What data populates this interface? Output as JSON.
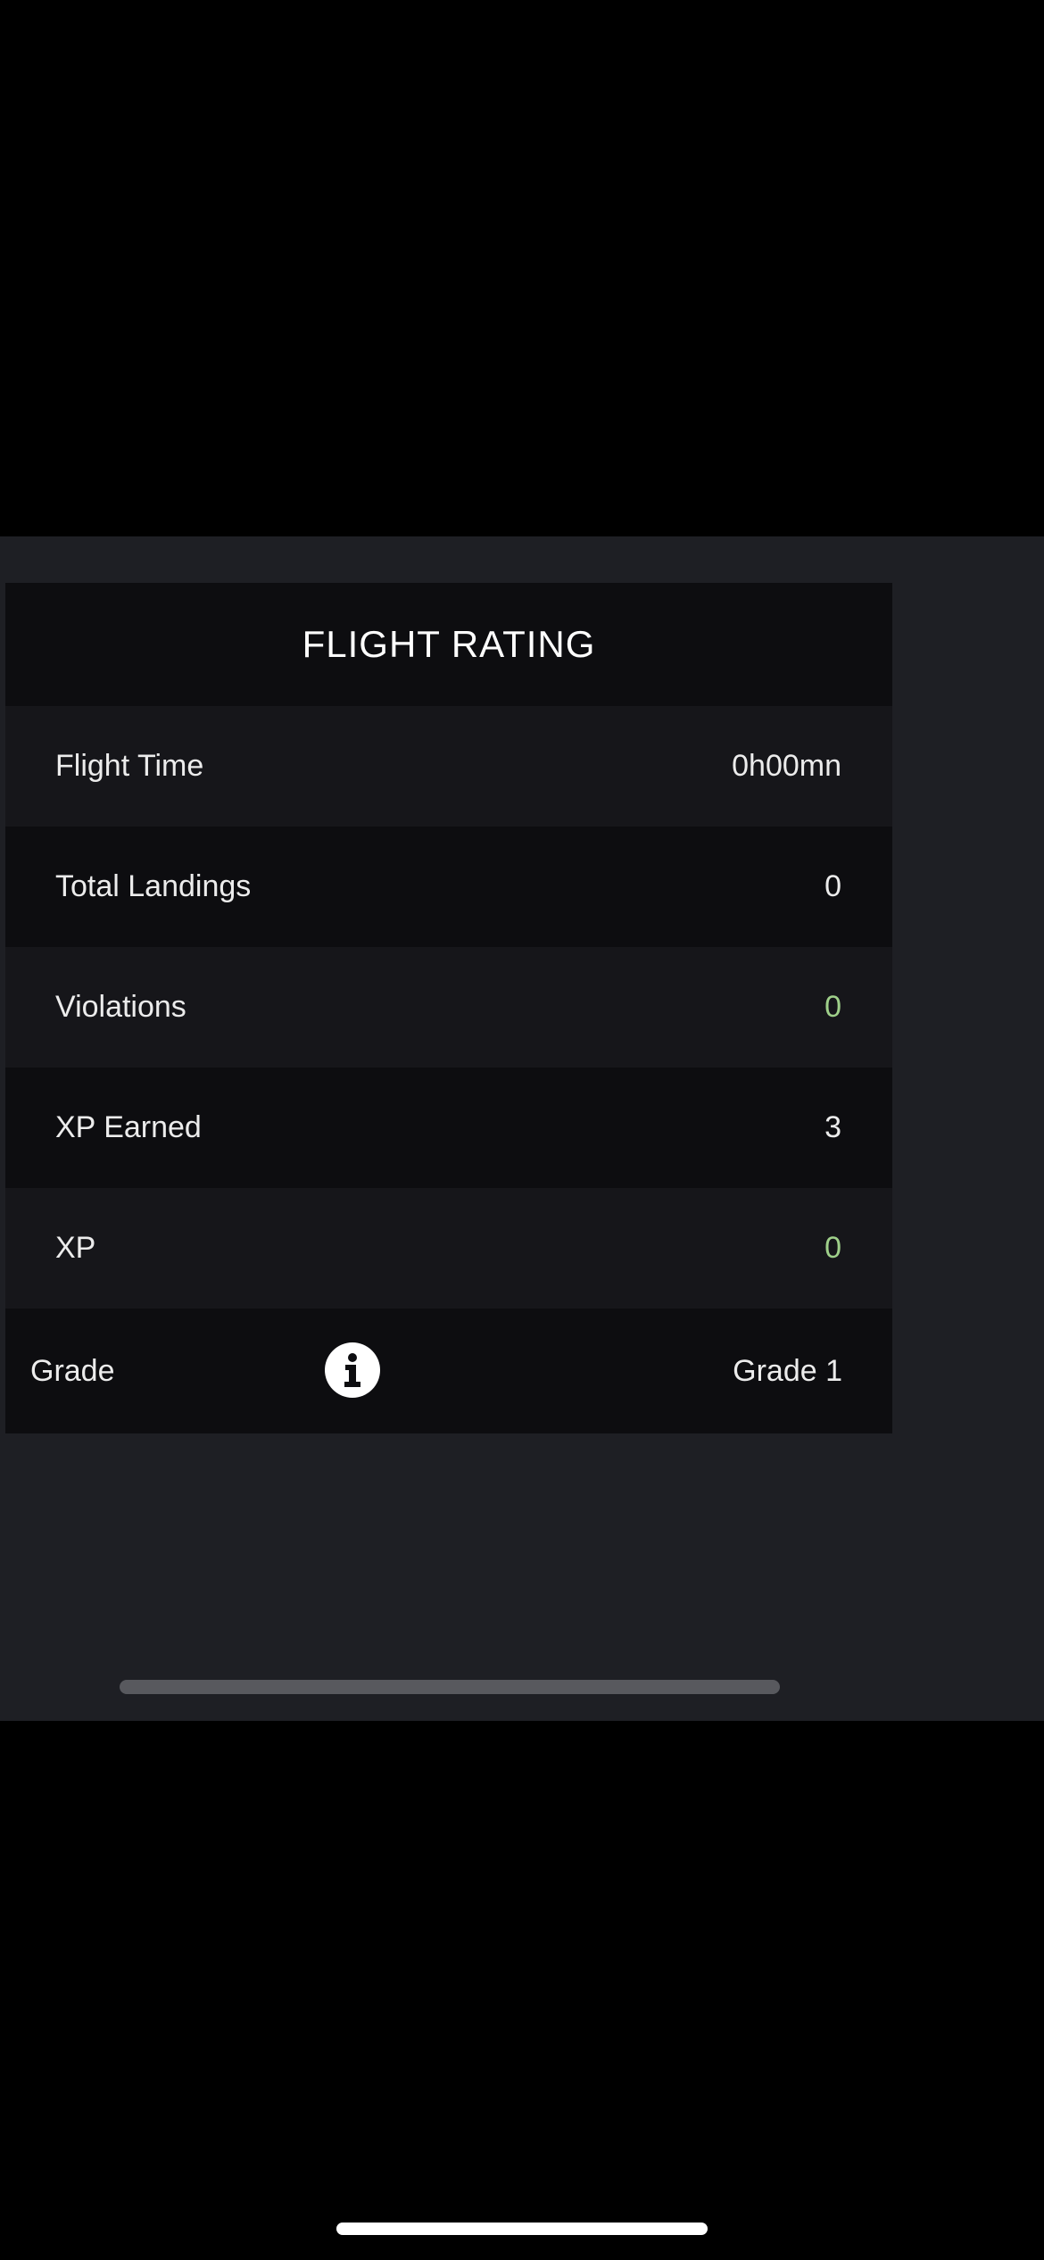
{
  "card": {
    "title": "FLIGHT RATING",
    "rows": [
      {
        "label": "Flight Time",
        "value": "0h00mn"
      },
      {
        "label": "Total Landings",
        "value": "0"
      },
      {
        "label": "Violations",
        "value": "0"
      },
      {
        "label": "XP Earned",
        "value": "3"
      },
      {
        "label": "XP",
        "value": "0"
      }
    ],
    "grade": {
      "label": "Grade",
      "value": "Grade 1",
      "icon": "info-icon"
    }
  },
  "colors": {
    "panel_background": "#1e1f24",
    "card_background": "#0d0d10",
    "row_alt_background": "#16161a",
    "positive_value": "#9fd08a",
    "text": "#ececec"
  }
}
